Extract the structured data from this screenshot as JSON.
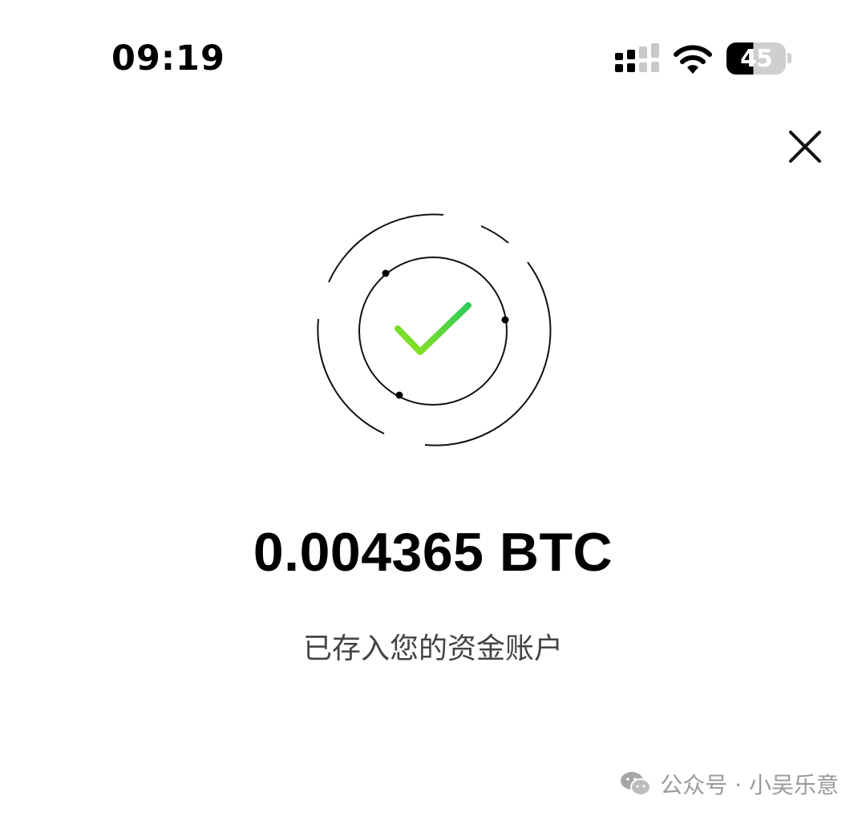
{
  "status_bar": {
    "time": "09:19",
    "battery_level": "45",
    "battery_fraction": 0.45
  },
  "close": {
    "icon": "close-icon"
  },
  "result": {
    "icon": "checkmark-icon",
    "amount": "0.004365 BTC",
    "message": "已存入您的资金账户"
  },
  "watermark": {
    "icon": "wechat-icon",
    "text": "公众号 · 小吴乐意"
  },
  "colors": {
    "check_start": "#8fe31c",
    "check_end": "#2fcc5a",
    "text_primary": "#000000",
    "text_secondary": "#444444",
    "watermark": "#9a9a9a"
  }
}
